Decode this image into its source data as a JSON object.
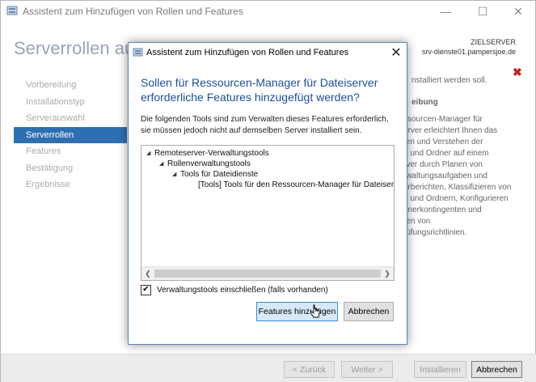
{
  "window": {
    "title": "Assistent zum Hinzufügen von Rollen und Features",
    "icons": {
      "app": "server-manager-icon",
      "minimize": "minimize-icon",
      "maximize": "maximize-icon",
      "close": "close-icon"
    }
  },
  "header": {
    "title": "Serverrollen ausw",
    "server_label": "ZIELSERVER",
    "server_name": "srv-dienste01.pampersjoe.de",
    "error_icon": "error-x-icon"
  },
  "nav": {
    "items": [
      {
        "label": "Vorbereitung"
      },
      {
        "label": "Installationstyp"
      },
      {
        "label": "Serverauswahl"
      },
      {
        "label": "Serverrollen"
      },
      {
        "label": "Features"
      },
      {
        "label": "Bestätigung"
      },
      {
        "label": "Ergebnisse"
      }
    ]
  },
  "right_panel": {
    "top_text": "nstalliert werden soll.",
    "heading": "eibung",
    "lines": [
      "ssourcen-Manager für",
      "erver erleichtert Ihnen das",
      "ten und Verstehen der",
      "n und Ordner auf einem",
      "rver durch Planen von",
      "rwaltungsaufgaben und",
      "erberichten, Klassifizieren von",
      "n und Ordnern, Konfigurieren",
      "dnerkontingenten und",
      "ren von",
      "rüfungsrichtlinien."
    ]
  },
  "footer": {
    "back_label": "< Zurück",
    "next_label": "Weiter >",
    "install_label": "Installieren",
    "cancel_label": "Abbrechen"
  },
  "dialog": {
    "title": "Assistent zum Hinzufügen von Rollen und Features",
    "heading_lines": [
      "Sollen für Ressourcen-Manager für Dateiserver",
      "erforderliche Features hinzugefügt werden?"
    ],
    "info_lines": [
      "Die folgenden Tools sind zum Verwalten dieses Features erforderlich,",
      "sie müssen jedoch nicht auf demselben Server installiert sein."
    ],
    "tree": [
      {
        "label": "Remoteserver-Verwaltungstools",
        "expander": "◢"
      },
      {
        "label": "Rollenverwaltungstools",
        "expander": "◢"
      },
      {
        "label": "Tools für Dateidienste",
        "expander": "◢"
      },
      {
        "label": "[Tools] Tools für den Ressourcen-Manager für Dateisen",
        "expander": ""
      }
    ],
    "checkbox": {
      "label": "Verwaltungstools einschließen (falls vorhanden)",
      "checked": true
    },
    "add_label": "Features hinzufügen",
    "cancel_label": "Abbrechen"
  }
}
